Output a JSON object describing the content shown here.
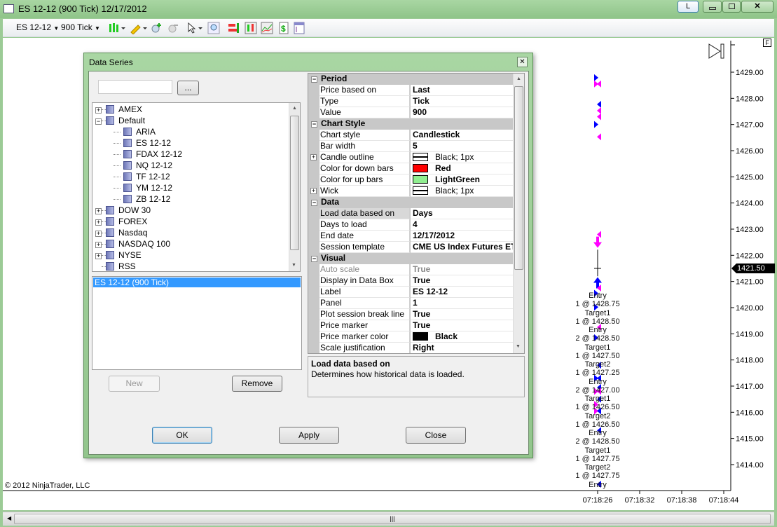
{
  "window": {
    "title": "ES 12-12 (900 Tick)  12/17/2012",
    "caption_buttons": {
      "link": "L",
      "minimize": "minimize-icon",
      "maximize": "maximize-icon",
      "close": "close-icon"
    }
  },
  "toolbar": {
    "instrument": "ES 12-12",
    "interval": "900 Tick",
    "icons": [
      "chart-style-icon",
      "drawing-tool-icon",
      "zoom-in-icon",
      "zoom-out-icon",
      "pointer-icon",
      "magnifier-icon",
      "data-series-icon",
      "indicators-icon",
      "strategies-icon",
      "dollar-icon",
      "properties-icon"
    ]
  },
  "chart": {
    "copyright": "© 2012 NinjaTrader, LLC",
    "price_axis": {
      "ticks": [
        "1429.00",
        "1428.00",
        "1427.00",
        "1426.00",
        "1425.00",
        "1424.00",
        "1423.00",
        "1422.00",
        "1421.00",
        "1420.00",
        "1419.00",
        "1418.00",
        "1417.00",
        "1416.00",
        "1415.00",
        "1414.00"
      ],
      "last_price": "1421.50"
    },
    "time_axis": {
      "ticks": [
        "07:18:26",
        "07:18:32",
        "07:18:38",
        "07:18:44"
      ]
    },
    "f_button": "F",
    "trade_labels": [
      "Entry",
      "1 @ 1428.75",
      "Target1",
      "1 @ 1428.50",
      "Entry",
      "2 @ 1428.50",
      "Target1",
      "1 @ 1427.50",
      "Target2",
      "1 @ 1427.25",
      "Entry",
      "2 @ 1427.00",
      "Target1",
      "1 @ 1426.50",
      "Target2",
      "1 @ 1426.50",
      "Entry",
      "2 @ 1428.50",
      "Target1",
      "1 @ 1427.75",
      "Target2",
      "1 @ 1427.75",
      "Entry"
    ],
    "markers": [
      {
        "price": 1428.79,
        "dir": "right",
        "color": "#0000ff"
      },
      {
        "price": 1428.55,
        "dir": "right",
        "color": "#ff00ff"
      },
      {
        "price": 1428.55,
        "dir": "left",
        "color": "#ff00ff"
      },
      {
        "price": 1427.77,
        "dir": "left",
        "color": "#0000ff"
      },
      {
        "price": 1427.53,
        "dir": "left",
        "color": "#ff00ff"
      },
      {
        "price": 1427.3,
        "dir": "left",
        "color": "#ff00ff"
      },
      {
        "price": 1427.0,
        "dir": "right",
        "color": "#0000ff"
      },
      {
        "price": 1426.53,
        "dir": "left",
        "color": "#ff00ff"
      },
      {
        "price": 1422.8,
        "dir": "left",
        "color": "#ff00ff"
      },
      {
        "price": 1420.75,
        "dir": "left",
        "color": "#ff00ff"
      },
      {
        "price": 1420.55,
        "dir": "right",
        "color": "#0000ff"
      },
      {
        "price": 1420.02,
        "dir": "right",
        "color": "#0000ff"
      },
      {
        "price": 1419.25,
        "dir": "left",
        "color": "#ff00ff"
      },
      {
        "price": 1418.85,
        "dir": "right",
        "color": "#0000ff"
      },
      {
        "price": 1417.8,
        "dir": "left",
        "color": "#0000ff"
      },
      {
        "price": 1417.3,
        "dir": "right",
        "color": "#0000ff"
      },
      {
        "price": 1417.3,
        "dir": "left",
        "color": "#0000ff"
      },
      {
        "price": 1416.95,
        "dir": "left",
        "color": "#0000ff"
      },
      {
        "price": 1416.8,
        "dir": "right",
        "color": "#ff00ff"
      },
      {
        "price": 1416.8,
        "dir": "left",
        "color": "#ff00ff"
      },
      {
        "price": 1416.5,
        "dir": "left",
        "color": "#0000ff"
      },
      {
        "price": 1416.3,
        "dir": "right",
        "color": "#ff00ff"
      },
      {
        "price": 1416.05,
        "dir": "right",
        "color": "#ff00ff"
      },
      {
        "price": 1416.05,
        "dir": "left",
        "color": "#0000ff"
      },
      {
        "price": 1415.3,
        "dir": "left",
        "color": "#0000ff"
      },
      {
        "price": 1413.25,
        "dir": "left",
        "color": "#0000ff"
      }
    ],
    "bar": {
      "time": "07:18:26",
      "open": 1421.5,
      "high": 1422.0,
      "low": 1421.25,
      "close": 1421.5
    },
    "arrows": [
      {
        "price": 1422.5,
        "dir": "down",
        "color": "#ff00ff"
      },
      {
        "price": 1420.95,
        "dir": "up",
        "color": "#0000ff"
      }
    ],
    "price_range": [
      1413.4,
      1429.7
    ]
  },
  "dialog": {
    "title": "Data Series",
    "search_value": "",
    "browse_label": "...",
    "tree": [
      {
        "label": "AMEX",
        "level": 0,
        "expander": "+"
      },
      {
        "label": "Default",
        "level": 0,
        "expander": "-"
      },
      {
        "label": "ARIA",
        "level": 1
      },
      {
        "label": "ES 12-12",
        "level": 1
      },
      {
        "label": "FDAX 12-12",
        "level": 1
      },
      {
        "label": "NQ 12-12",
        "level": 1
      },
      {
        "label": "TF 12-12",
        "level": 1
      },
      {
        "label": "YM 12-12",
        "level": 1
      },
      {
        "label": "ZB 12-12",
        "level": 1
      },
      {
        "label": "DOW 30",
        "level": 0,
        "expander": "+"
      },
      {
        "label": "FOREX",
        "level": 0,
        "expander": "+"
      },
      {
        "label": "Nasdaq",
        "level": 0,
        "expander": "+"
      },
      {
        "label": "NASDAQ 100",
        "level": 0,
        "expander": "+"
      },
      {
        "label": "NYSE",
        "level": 0,
        "expander": "+"
      },
      {
        "label": "RSS",
        "level": 0
      }
    ],
    "series_list": [
      "ES 12-12 (900 Tick)"
    ],
    "new_label": "New",
    "remove_label": "Remove",
    "properties": [
      {
        "category": "Period"
      },
      {
        "name": "Price based on",
        "value": "Last"
      },
      {
        "name": "Type",
        "value": "Tick"
      },
      {
        "name": "Value",
        "value": "900"
      },
      {
        "category": "Chart Style"
      },
      {
        "name": "Chart style",
        "value": "Candlestick"
      },
      {
        "name": "Bar width",
        "value": "5"
      },
      {
        "name": "Candle outline",
        "value": "Black; 1px",
        "expander": "+",
        "swatch": "line"
      },
      {
        "name": "Color for down bars",
        "value": "Red",
        "swatch": "#ff0000"
      },
      {
        "name": "Color for up bars",
        "value": "LightGreen",
        "swatch": "#90ee90"
      },
      {
        "name": "Wick",
        "value": "Black; 1px",
        "expander": "+",
        "swatch": "line"
      },
      {
        "category": "Data"
      },
      {
        "name": "Load data based on",
        "value": "Days",
        "selected": true
      },
      {
        "name": "Days to load",
        "value": "4"
      },
      {
        "name": "End date",
        "value": "12/17/2012"
      },
      {
        "name": "Session template",
        "value": "CME US Index Futures ETH"
      },
      {
        "category": "Visual"
      },
      {
        "name": "Auto scale",
        "value": "True",
        "disabled": true
      },
      {
        "name": "Display in Data Box",
        "value": "True"
      },
      {
        "name": "Label",
        "value": "ES 12-12"
      },
      {
        "name": "Panel",
        "value": "1"
      },
      {
        "name": "Plot session break line",
        "value": "True"
      },
      {
        "name": "Price marker",
        "value": "True"
      },
      {
        "name": "Price marker color",
        "value": "Black",
        "swatch": "#000000"
      },
      {
        "name": "Scale justification",
        "value": "Right"
      }
    ],
    "description": {
      "title": "Load data based on",
      "text": "Determines how historical data is loaded."
    },
    "ok_label": "OK",
    "apply_label": "Apply",
    "close_label": "Close"
  }
}
